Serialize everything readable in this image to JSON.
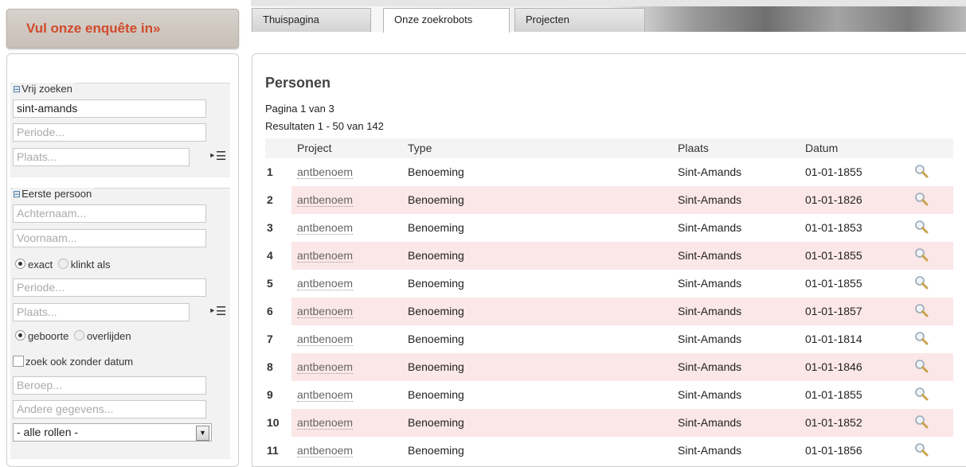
{
  "survey_label": "Vul onze enquête in»",
  "tabs": [
    {
      "label": "Thuispagina",
      "active": false
    },
    {
      "label": "Onze zoekrobots",
      "active": true
    },
    {
      "label": "Projecten",
      "active": false
    }
  ],
  "sidebar": {
    "free_search": {
      "legend": "Vrij zoeken",
      "query_value": "sint-amands",
      "period_placeholder": "Periode...",
      "place_placeholder": "Plaats..."
    },
    "first_person": {
      "legend": "Eerste persoon",
      "lastname_placeholder": "Achternaam...",
      "firstname_placeholder": "Voornaam...",
      "match_options": [
        {
          "label": "exact",
          "selected": true
        },
        {
          "label": "klinkt als",
          "selected": false
        }
      ],
      "period_placeholder": "Periode...",
      "place_placeholder": "Plaats...",
      "event_options": [
        {
          "label": "geboorte",
          "selected": true
        },
        {
          "label": "overlijden",
          "selected": false
        }
      ],
      "no_date_label": "zoek ook zonder datum",
      "occupation_placeholder": "Beroep...",
      "other_placeholder": "Andere gegevens...",
      "role_select": "- alle rollen -"
    }
  },
  "results": {
    "title": "Personen",
    "page_info": "Pagina 1 van 3",
    "range_info": "Resultaten 1 - 50 van 142",
    "columns": {
      "project": "Project",
      "type": "Type",
      "plaats": "Plaats",
      "datum": "Datum"
    },
    "rows": [
      {
        "num": "1",
        "project": "antbenoem",
        "type": "Benoeming",
        "plaats": "Sint-Amands",
        "datum": "01-01-1855"
      },
      {
        "num": "2",
        "project": "antbenoem",
        "type": "Benoeming",
        "plaats": "Sint-Amands",
        "datum": "01-01-1826"
      },
      {
        "num": "3",
        "project": "antbenoem",
        "type": "Benoeming",
        "plaats": "Sint-Amands",
        "datum": "01-01-1853"
      },
      {
        "num": "4",
        "project": "antbenoem",
        "type": "Benoeming",
        "plaats": "Sint-Amands",
        "datum": "01-01-1855"
      },
      {
        "num": "5",
        "project": "antbenoem",
        "type": "Benoeming",
        "plaats": "Sint-Amands",
        "datum": "01-01-1855"
      },
      {
        "num": "6",
        "project": "antbenoem",
        "type": "Benoeming",
        "plaats": "Sint-Amands",
        "datum": "01-01-1857"
      },
      {
        "num": "7",
        "project": "antbenoem",
        "type": "Benoeming",
        "plaats": "Sint-Amands",
        "datum": "01-01-1814"
      },
      {
        "num": "8",
        "project": "antbenoem",
        "type": "Benoeming",
        "plaats": "Sint-Amands",
        "datum": "01-01-1846"
      },
      {
        "num": "9",
        "project": "antbenoem",
        "type": "Benoeming",
        "plaats": "Sint-Amands",
        "datum": "01-01-1855"
      },
      {
        "num": "10",
        "project": "antbenoem",
        "type": "Benoeming",
        "plaats": "Sint-Amands",
        "datum": "01-01-1852"
      },
      {
        "num": "11",
        "project": "antbenoem",
        "type": "Benoeming",
        "plaats": "Sint-Amands",
        "datum": "01-01-1856"
      }
    ]
  },
  "colors": {
    "survey_text": "#d04a2a",
    "alt_row": "#fbe7e7",
    "header_bg": "#f4f4f4"
  },
  "icons": {
    "toggle": "collapse-minus-icon",
    "place_list": "list-picker-icon",
    "row_action": "magnifier-icon"
  }
}
